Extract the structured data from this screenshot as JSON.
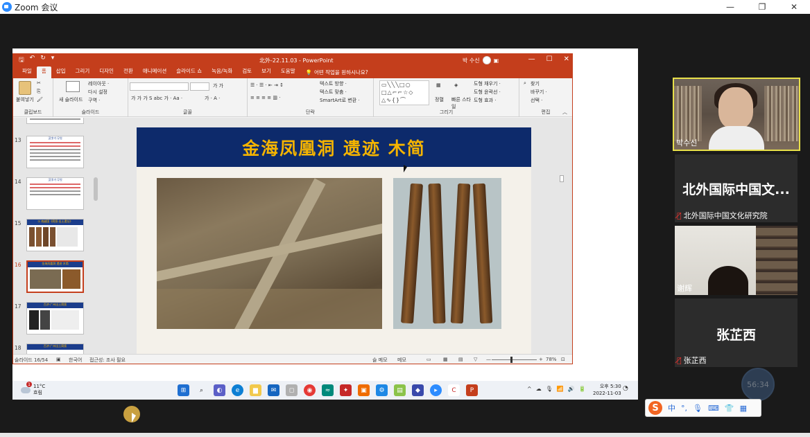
{
  "zoom": {
    "title": "Zoom 会议",
    "window_controls": [
      "—",
      "❐",
      "✕"
    ]
  },
  "ppt": {
    "qat_icons": [
      "save-icon",
      "undo-icon",
      "redo-icon",
      "customize-icon"
    ],
    "title": "北外-22.11.03  -  PowerPoint",
    "user_name": "박 수신",
    "window_controls": [
      "—",
      "☐",
      "✕"
    ],
    "menu": [
      "파일",
      "홈",
      "삽입",
      "그리기",
      "디자인",
      "전환",
      "애니메이션",
      "슬라이드 쇼",
      "녹음/녹화",
      "검토",
      "보기",
      "도움말"
    ],
    "active_menu_index": 1,
    "tellme": "어떤 작업을 원하시나요?",
    "ribbon": {
      "paste": "붙여넣기",
      "clipboard_label": "클립보드",
      "new_slide": "새 슬라이드",
      "layout": "레이아웃 ·",
      "reset": "다시 설정",
      "section": "구역 ·",
      "slides_label": "슬라이드",
      "font_label": "글꼴",
      "paragraph_label": "단락",
      "text_direction": "텍스트 방향 ·",
      "text_align": "텍스트 맞춤 ·",
      "smartart": "SmartArt로 변환 ·",
      "arrange": "정렬",
      "quick_styles": "빠른 스타일",
      "shape_fill": "도형 채우기 ·",
      "shape_outline": "도형 윤곽선 ·",
      "shape_effects": "도형 효과 ·",
      "drawing_label": "그리기",
      "find": "찾기",
      "replace": "바꾸기 ·",
      "select": "선택 ·",
      "editing_label": "편집"
    },
    "thumbnails": [
      {
        "num": "13",
        "title": "汉字가 무엇"
      },
      {
        "num": "14",
        "title": "汉字가 무엇"
      },
      {
        "num": "15",
        "title": "① 南越国《简牍·出土遗址》"
      },
      {
        "num": "16",
        "title": "金海凤凰洞 遗迹 木简"
      },
      {
        "num": "17",
        "title": "百济·广州出土简牍"
      },
      {
        "num": "18",
        "title": "百济·广州出土简牍"
      }
    ],
    "selected_thumbnail": 3,
    "slide": {
      "title": "金海凤凰洞 遗迹 木简"
    },
    "status": {
      "slide_info": "슬라이드 16/54",
      "language": "한국어",
      "accessibility": "접근성: 조사 필요",
      "notes": "슬 메모",
      "comments": "메모",
      "zoom_level": "78%",
      "zoom_fraction": 0.78
    }
  },
  "taskbar": {
    "weather_temp": "11°C",
    "weather_desc": "흐림",
    "notification_count": "1",
    "time": "오후 5:30",
    "date": "2022-11-03",
    "tray": [
      "^",
      "☁",
      "🎙",
      "📶",
      "🔊",
      "🔋"
    ]
  },
  "participants": [
    {
      "label": "박수신",
      "muted": false
    },
    {
      "display": "北外国际中国文...",
      "label": "北外国际中国文化研究院",
      "muted": true
    },
    {
      "label": "谢辉",
      "muted": false
    },
    {
      "display": "张芷西",
      "label": "张芷西",
      "muted": true
    }
  ],
  "timer": "56:34",
  "ime": {
    "logo": "S",
    "mode": "中",
    "punct": "°,"
  }
}
